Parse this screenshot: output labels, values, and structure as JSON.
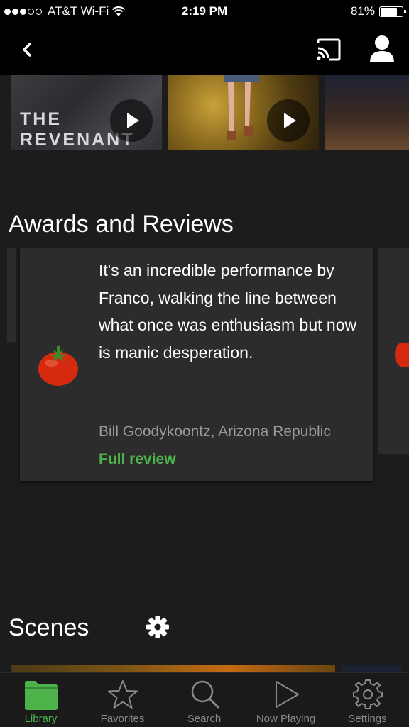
{
  "status_bar": {
    "carrier": "AT&T Wi-Fi",
    "time": "2:19 PM",
    "battery": "81%",
    "battery_level": 0.81
  },
  "nav": {
    "back_icon": "chevron-left-icon",
    "cast_icon": "cast-icon",
    "profile_icon": "user-icon"
  },
  "related_videos": [
    {
      "title_text": "THE REVENANT",
      "play_icon": "play-icon"
    },
    {
      "play_icon": "play-icon"
    },
    {}
  ],
  "awards_reviews": {
    "heading": "Awards and Reviews",
    "review": {
      "icon": "tomato-icon",
      "quote": "It's an incredible performance by Franco, walking the line between what once was enthusiasm but now is manic desperation.",
      "critic": "Bill Goodykoontz, Arizona Republic",
      "link_label": "Full review"
    }
  },
  "scenes": {
    "heading": "Scenes",
    "settings_icon": "gear-icon"
  },
  "tab_bar": {
    "tabs": [
      {
        "label": "Library",
        "icon": "folder-icon",
        "active": true
      },
      {
        "label": "Favorites",
        "icon": "star-icon",
        "active": false
      },
      {
        "label": "Search",
        "icon": "search-icon",
        "active": false
      },
      {
        "label": "Now Playing",
        "icon": "play-outline-icon",
        "active": false
      },
      {
        "label": "Settings",
        "icon": "gear-icon",
        "active": false
      }
    ]
  },
  "colors": {
    "accent": "#4db24a",
    "background": "#1c1c1c",
    "card": "#2c2c2c",
    "bar": "#000000"
  }
}
